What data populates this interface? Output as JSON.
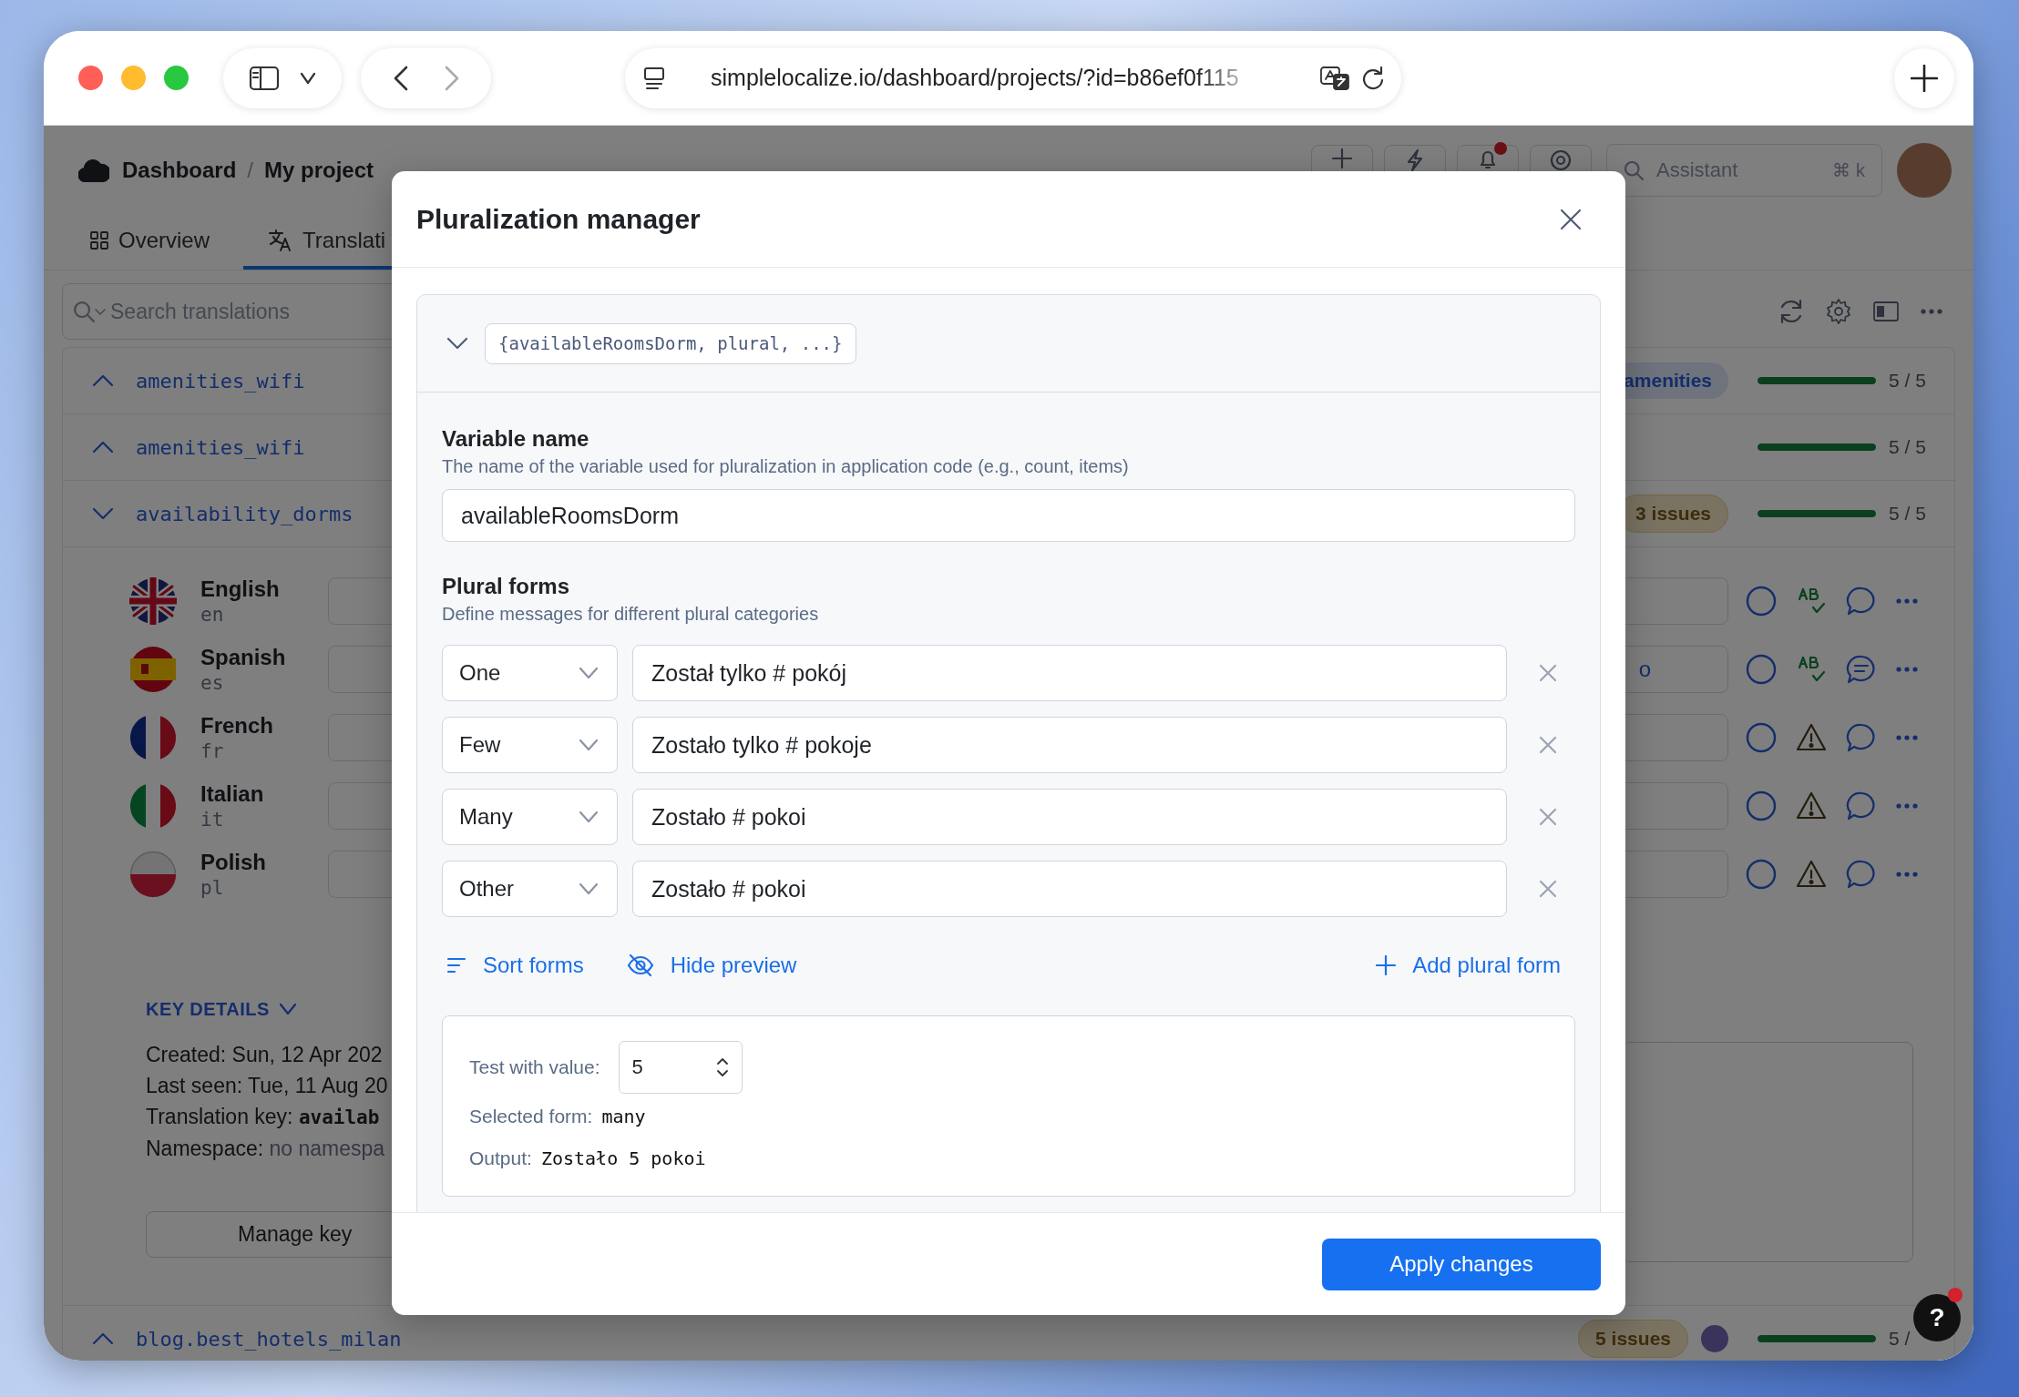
{
  "browser": {
    "url": "simplelocalize.io/dashboard/projects/?id=b86ef0f115"
  },
  "header": {
    "breadcrumb": [
      "Dashboard",
      "My project"
    ],
    "separator": "/",
    "notifications": true,
    "assistant": "Assistant",
    "shortcut": "⌘ k"
  },
  "tabs": [
    {
      "label": "Overview",
      "selected": false
    },
    {
      "label": "Translati",
      "selected": true
    }
  ],
  "search": {
    "placeholder": "Search translations"
  },
  "keys": [
    {
      "key": "amenities_wifi",
      "expanded": false,
      "badges": [
        {
          "kind": "tag",
          "label": "amenities"
        }
      ],
      "assigned": false,
      "level": 1,
      "progress": "5 / 5"
    },
    {
      "key": "amenities_wifi",
      "expanded": false,
      "assigned": false,
      "level": 1,
      "progress": "5 / 5"
    },
    {
      "key": "availability_dorms",
      "expanded": true,
      "badges": [
        {
          "kind": "issues",
          "label": "3 issues"
        }
      ],
      "assigned": false,
      "level": 1,
      "progress": "5 / 5",
      "languages": [
        {
          "name": "English",
          "code": "en",
          "kind": "gb",
          "warning": false,
          "comments": false
        },
        {
          "name": "Spanish",
          "code": "es",
          "kind": "es",
          "value": "o",
          "warning": false,
          "comments": true
        },
        {
          "name": "French",
          "code": "fr",
          "kind": "fr",
          "warning": true,
          "comments": false
        },
        {
          "name": "Italian",
          "code": "it",
          "kind": "it",
          "warning": true,
          "comments": false
        },
        {
          "name": "Polish",
          "code": "pl",
          "kind": "pl",
          "warning": true,
          "comments": false
        }
      ],
      "details": {
        "toggle": "KEY DETAILS",
        "lines": [
          {
            "label": "Created:",
            "value": "Sun, 12 Apr 202",
            "kind": "plain"
          },
          {
            "label": "Last seen:",
            "value": "Tue, 11 Aug 20",
            "kind": "plain"
          },
          {
            "label": "Translation key:",
            "value": "availab",
            "kind": "code"
          },
          {
            "label": "Namespace:",
            "value": "no namespa",
            "kind": "muted"
          }
        ],
        "button": "Manage key"
      }
    },
    {
      "key": "blog.best_hotels_milan",
      "expanded": false,
      "badges": [
        {
          "kind": "issues",
          "label": "5 issues"
        }
      ],
      "assigned": true,
      "level": 1,
      "progress": "5 /"
    }
  ],
  "help": {
    "label": "?",
    "notification": true
  },
  "modal": {
    "title": "Pluralization manager",
    "icu": "{availableRoomsDorm, plural, ...}",
    "variable": {
      "label": "Variable name",
      "hint": "The name of the variable used for pluralization in application code (e.g., count, items)",
      "value": "availableRoomsDorm"
    },
    "plural": {
      "label": "Plural forms",
      "hint": "Define messages for different plural categories",
      "forms": [
        {
          "category": "One",
          "message": "Został tylko # pokój"
        },
        {
          "category": "Few",
          "message": "Zostało tylko # pokoje"
        },
        {
          "category": "Many",
          "message": "Zostało # pokoi"
        },
        {
          "category": "Other",
          "message": "Zostało # pokoi"
        }
      ]
    },
    "actions": [
      {
        "kind": "sort",
        "label": "Sort forms"
      },
      {
        "kind": "hide",
        "label": "Hide preview"
      },
      {
        "kind": "add",
        "label": "Add plural form"
      }
    ],
    "preview": {
      "test_label": "Test with value:",
      "test_value": "5",
      "form_label": "Selected form:",
      "form": "many",
      "output_label": "Output:",
      "output": "Zostało 5 pokoi"
    },
    "apply": "Apply changes"
  }
}
